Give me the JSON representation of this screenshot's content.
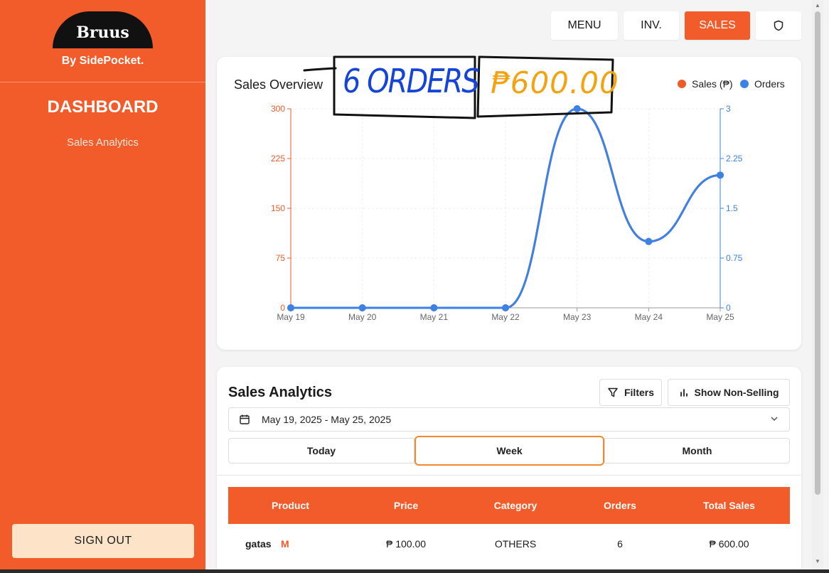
{
  "sidebar": {
    "logo": "Bruus",
    "byline": "By SidePocket.",
    "title": "DASHBOARD",
    "link": "Sales Analytics",
    "signout": "SIGN OUT"
  },
  "nav": {
    "menu": "MENU",
    "inv": "INV.",
    "sales": "SALES",
    "shield_icon": "shield-icon"
  },
  "overview": {
    "title": "Sales Overview",
    "annotation_orders": "6 ORDERS",
    "annotation_sales": "₱600.00",
    "legend": [
      {
        "label": "Sales (₱)",
        "color": "#f05a28"
      },
      {
        "label": "Orders",
        "color": "#3b82e6"
      }
    ]
  },
  "chart_data": {
    "type": "line",
    "x": [
      "May 19",
      "May 20",
      "May 21",
      "May 22",
      "May 23",
      "May 24",
      "May 25"
    ],
    "y_left_ticks": [
      "0",
      "75",
      "150",
      "225",
      "300"
    ],
    "y_right_ticks": [
      "0",
      "0.75",
      "1.5",
      "2.25",
      "3"
    ],
    "y_left_range": [
      0,
      300
    ],
    "y_right_range": [
      0,
      3
    ],
    "series": [
      {
        "name": "Sales (₱)",
        "axis": "left",
        "color": "#f05a28",
        "values": [
          0,
          0,
          0,
          0,
          300,
          100,
          200
        ]
      },
      {
        "name": "Orders",
        "axis": "right",
        "color": "#3b82e6",
        "values": [
          0,
          0,
          0,
          0,
          3,
          1,
          2
        ]
      }
    ],
    "grid": true,
    "legend_position": "top-right"
  },
  "analytics": {
    "title": "Sales Analytics",
    "filters": "Filters",
    "show_non_selling": "Show Non-Selling",
    "date_range": "May 19, 2025 - May 25, 2025",
    "segments": [
      "Today",
      "Week",
      "Month"
    ],
    "active_segment": "Week",
    "columns": [
      "Product",
      "Price",
      "Category",
      "Orders",
      "Total Sales"
    ],
    "rows": [
      {
        "product": "gatas",
        "size": "M",
        "price": "₱ 100.00",
        "category": "OTHERS",
        "orders": "6",
        "total": "₱ 600.00"
      }
    ]
  },
  "colors": {
    "brand": "#f25c2a",
    "signout_bg": "#fde3c7",
    "orders_line": "#3b82e6",
    "sales_axis": "#f05a28"
  }
}
